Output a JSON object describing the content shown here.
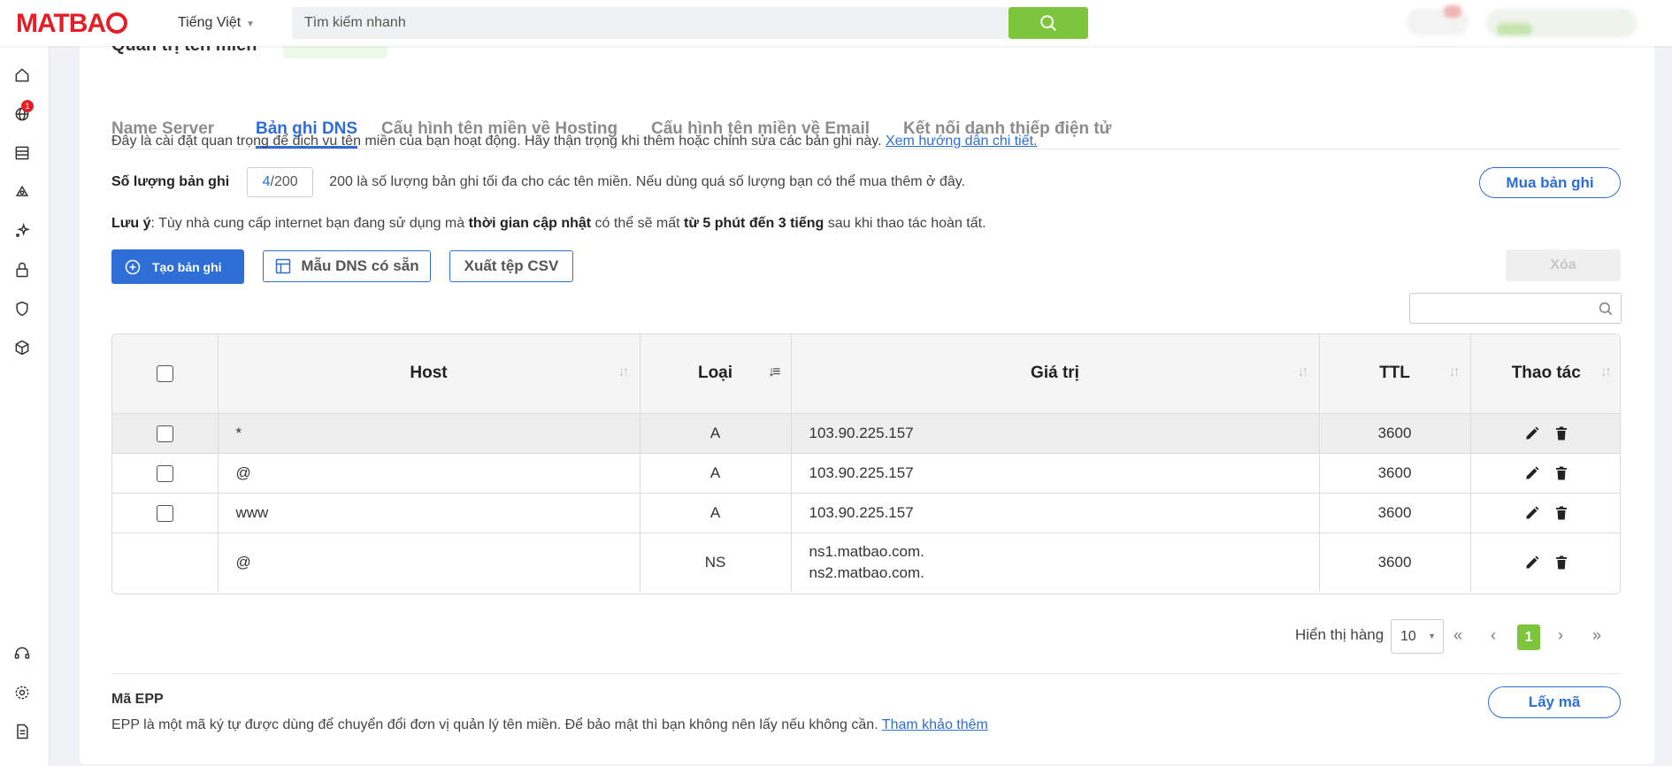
{
  "header": {
    "logo": "MATBAO",
    "language": "Tiếng Việt",
    "search_placeholder": "Tìm kiếm nhanh"
  },
  "sidebar": {
    "badge_count": "1",
    "icons": [
      "home-icon",
      "globe-icon",
      "server-icon",
      "cloud-icon",
      "sparkle-icon",
      "lock-icon",
      "shield-icon",
      "box-icon",
      "headset-icon",
      "gear-icon",
      "document-icon"
    ]
  },
  "page": {
    "title": "Quản trị tên miền"
  },
  "tabs": [
    {
      "label": "Name Server"
    },
    {
      "label": "Bản ghi DNS"
    },
    {
      "label": "Cấu hình tên miền về Hosting"
    },
    {
      "label": "Cấu hình tên miền về Email"
    },
    {
      "label": "Kết nối danh thiếp điện tử"
    }
  ],
  "notice": {
    "text": "Đây là cài đặt quan trọng để dịch vụ tên miền của bạn hoạt động. Hãy thận trọng khi thêm hoặc chỉnh sửa các bản ghi này.",
    "link": "Xem hướng dẫn chi tiết."
  },
  "records": {
    "label": "Số lượng bản ghi",
    "used": "4",
    "limit": "/200",
    "desc": "200 là số lượng bản ghi tối đa cho các tên miền. Nếu dùng quá số lượng bạn có thể mua thêm ở đây.",
    "buy_button": "Mua bản ghi"
  },
  "note": {
    "label": "Lưu ý",
    "p1": ": Tùy nhà cung cấp internet bạn đang sử dụng mà ",
    "b1": "thời gian cập nhật",
    "p2": " có thể sẽ mất ",
    "b2": "từ 5 phút đến 3 tiếng",
    "p3": " sau khi thao tác hoàn tất."
  },
  "toolbar": {
    "create": "Tạo bản ghi",
    "template": "Mẫu DNS có sẵn",
    "export": "Xuất tệp CSV",
    "delete": "Xóa"
  },
  "table": {
    "headers": [
      "Host",
      "Loại",
      "Giá trị",
      "TTL",
      "Thao tác"
    ],
    "rows": [
      {
        "host": "*",
        "type": "A",
        "value": "103.90.225.157",
        "value2": "",
        "ttl": "3600"
      },
      {
        "host": "@",
        "type": "A",
        "value": "103.90.225.157",
        "value2": "",
        "ttl": "3600"
      },
      {
        "host": "www",
        "type": "A",
        "value": "103.90.225.157",
        "value2": "",
        "ttl": "3600"
      },
      {
        "host": "@",
        "type": "NS",
        "value": "ns1.matbao.com.",
        "value2": "ns2.matbao.com.",
        "ttl": "3600"
      }
    ]
  },
  "pagination": {
    "label": "Hiển thị hàng",
    "page_size": "10",
    "first": "«",
    "prev": "‹",
    "current": "1",
    "next": "›",
    "last": "»"
  },
  "epp": {
    "title": "Mã EPP",
    "desc": "EPP là một mã ký tự được dùng để chuyển đổi đơn vị quản lý tên miền. Để bảo mật thì bạn không nên lấy nếu không cần.",
    "link": "Tham khảo thêm",
    "button": "Lấy mã"
  },
  "colors": {
    "brand_red": "#e41e26",
    "primary_blue": "#2d6fd6",
    "accent_green": "#7cc53c"
  }
}
